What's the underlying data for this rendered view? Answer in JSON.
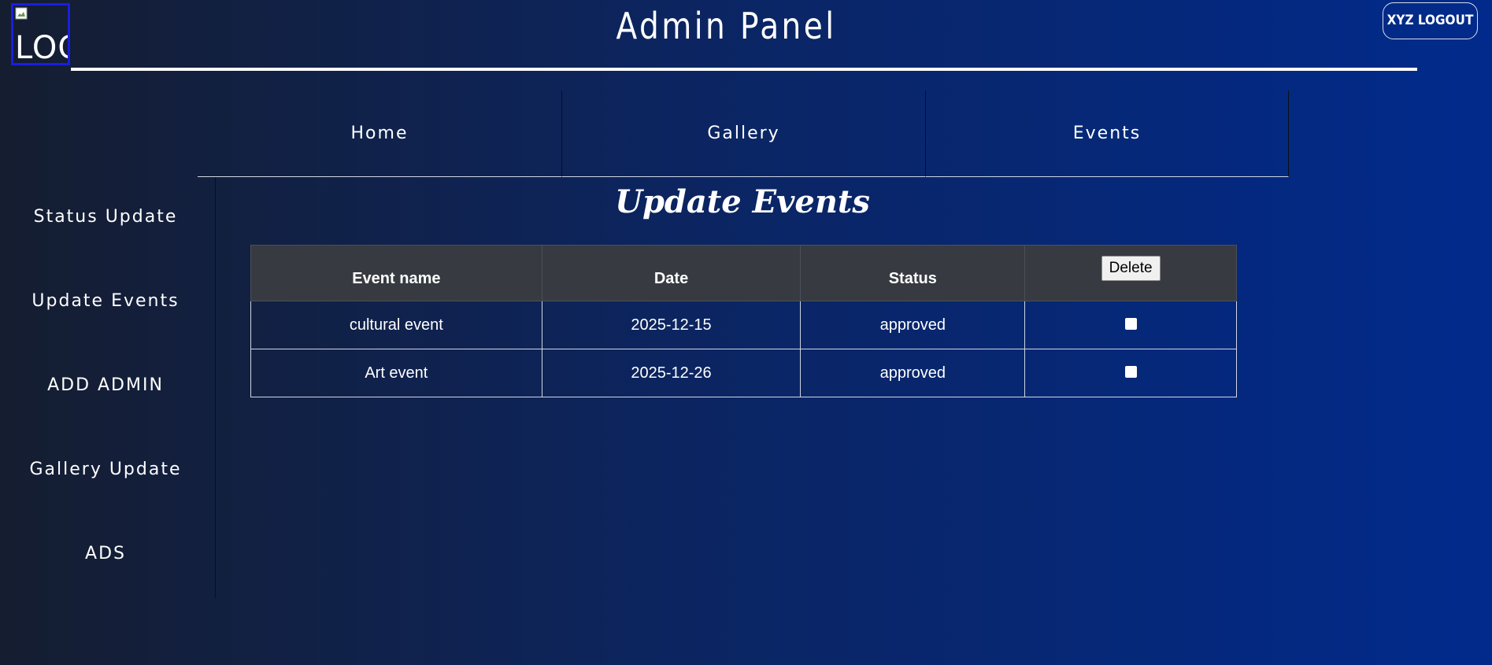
{
  "header": {
    "logo_alt": "LOG",
    "title": "Admin Panel",
    "logout_label": "XYZ LOGOUT"
  },
  "top_nav": {
    "items": [
      {
        "label": "Home"
      },
      {
        "label": "Gallery"
      },
      {
        "label": "Events"
      }
    ]
  },
  "sidebar": {
    "items": [
      {
        "label": "Status Update"
      },
      {
        "label": "Update Events"
      },
      {
        "label": "ADD ADMIN"
      },
      {
        "label": "Gallery Update"
      },
      {
        "label": "ADS"
      }
    ]
  },
  "main": {
    "title": "Update Events",
    "table": {
      "columns": [
        "Event name",
        "Date",
        "Status"
      ],
      "delete_label": "Delete",
      "rows": [
        {
          "event_name": "cultural event",
          "date": "2025-12-15",
          "status": "approved",
          "selected": false
        },
        {
          "event_name": "Art event",
          "date": "2025-12-26",
          "status": "approved",
          "selected": false
        }
      ]
    }
  },
  "colors": {
    "background_start": "#151d30",
    "background_end": "#012a8c",
    "table_header": "#373b41",
    "logo_border": "#1a1ee0"
  }
}
